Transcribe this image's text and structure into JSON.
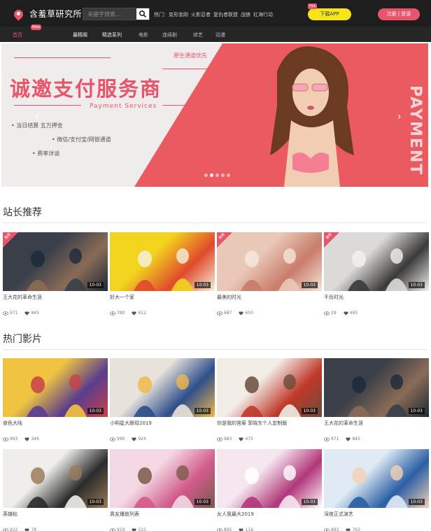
{
  "header": {
    "site_name": "含羞草研究所",
    "search_placeholder": "关键字搜索...",
    "hot_links": [
      "热门：变形金刚",
      "火影忍者",
      "复仇者联盟",
      "战狼",
      "红海行动"
    ],
    "app_badge": "Hot",
    "app_button": "下载APP",
    "login_button": "注册 | 登录"
  },
  "nav": {
    "items": [
      "首页",
      "最精阁",
      "精选系列",
      "电影",
      "连续剧",
      "综艺",
      "动漫"
    ],
    "new_badge": "New"
  },
  "banner": {
    "tag": "原生通道优先",
    "title": "诚邀支付服务商",
    "subtitle": "Payment Services",
    "features": [
      "• 当日结算  五万押金",
      "• 微信/支付宝/网银通道",
      "• 费率详谈"
    ],
    "side_text": "PAYMENT",
    "slide_count": 5,
    "active_slide": 1
  },
  "recommend": {
    "title": "站长推荐",
    "cards": [
      {
        "title": "王大花的革命生涯",
        "date": "10-03",
        "views": "971",
        "likes": "845",
        "badge": "推荐",
        "colors": [
          "#3a3f4a",
          "#8a6b56",
          "#1d2a3a"
        ]
      },
      {
        "title": "好大一个家",
        "date": "10-03",
        "views": "780",
        "likes": "612",
        "badge": "",
        "colors": [
          "#f2d31d",
          "#e04a2c",
          "#f5f0d8"
        ]
      },
      {
        "title": "最美的时光",
        "date": "10-03",
        "views": "687",
        "likes": "650",
        "badge": "推荐",
        "colors": [
          "#e9c8b8",
          "#c97c6a",
          "#f4e6da"
        ]
      },
      {
        "title": "不负时光",
        "date": "10-03",
        "views": "29",
        "likes": "495",
        "badge": "推荐",
        "colors": [
          "#dcdad6",
          "#3b3a3a",
          "#f2f0ec"
        ]
      }
    ]
  },
  "hot": {
    "title": "热门影片",
    "cards": [
      {
        "title": "食色大陆",
        "date": "10-03",
        "views": "993",
        "likes": "346",
        "badge": "",
        "colors": [
          "#f0c440",
          "#5a3d8e",
          "#c8414a"
        ]
      },
      {
        "title": "小明星大跟班2019",
        "date": "10-03",
        "views": "990",
        "likes": "924",
        "badge": "",
        "colors": [
          "#e7e2da",
          "#2e4f8a",
          "#f0b84c"
        ]
      },
      {
        "title": "你是我的答案 郭晓东个人定制版",
        "date": "10-03",
        "views": "983",
        "likes": "475",
        "badge": "",
        "colors": [
          "#f1ece6",
          "#c0392b",
          "#6b4b3a"
        ]
      },
      {
        "title": "王大花的革命生涯",
        "date": "10-03",
        "views": "971",
        "likes": "845",
        "badge": "",
        "colors": [
          "#3a3f4a",
          "#8a6b56",
          "#1d2a3a"
        ]
      },
      {
        "title": "英雄帖",
        "date": "10-03",
        "views": "922",
        "likes": "78",
        "badge": "",
        "colors": [
          "#efeeea",
          "#2b2b2b",
          "#9a7a5a"
        ]
      },
      {
        "title": "男友播放列表",
        "date": "10-03",
        "views": "919",
        "likes": "515",
        "badge": "",
        "colors": [
          "#f3d7e2",
          "#d25a8c",
          "#7a5a4a"
        ]
      },
      {
        "title": "女人我最大2019",
        "date": "10-03",
        "views": "895",
        "likes": "116",
        "badge": "",
        "colors": [
          "#f6e6ef",
          "#b0377a",
          "#ffffff"
        ]
      },
      {
        "title": "深夜正式演艺",
        "date": "10-03",
        "views": "893",
        "likes": "763",
        "badge": "",
        "colors": [
          "#dfeaf5",
          "#2a5fa3",
          "#f2d2b8"
        ]
      }
    ]
  },
  "labels": {
    "new": "New"
  },
  "colors": {
    "accent": "#e8556b",
    "topbar": "#1e1e1e",
    "navbar": "#262626",
    "app": "#f5e418"
  }
}
